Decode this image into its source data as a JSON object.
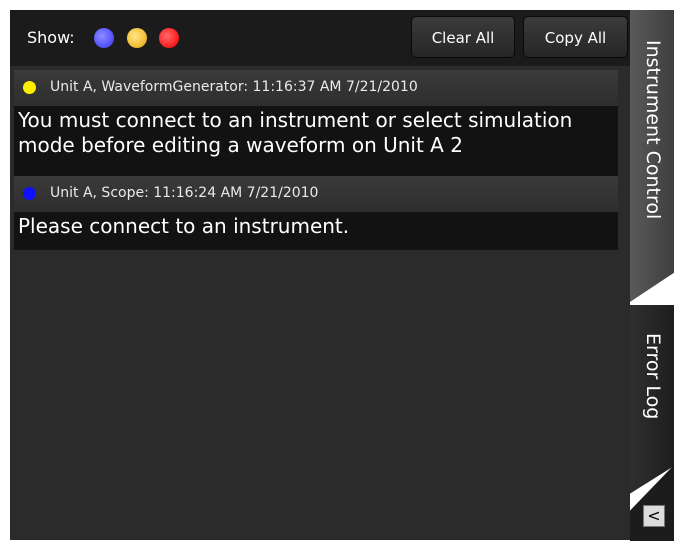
{
  "toolbar": {
    "show_label": "Show:",
    "filters": [
      {
        "name": "blue",
        "color": "#5a5aff"
      },
      {
        "name": "yellow",
        "color": "#f3c33c"
      },
      {
        "name": "red",
        "color": "#ff2a2a"
      }
    ],
    "clear_all_label": "Clear All",
    "copy_all_label": "Copy All"
  },
  "entries": [
    {
      "level_color": "#ffee00",
      "header": "Unit A, WaveformGenerator:  11:16:37 AM 7/21/2010",
      "message": "You must connect to an instrument or select simulation mode before editing a waveform on Unit A 2"
    },
    {
      "level_color": "#1010ff",
      "header": "Unit A, Scope:  11:16:24 AM 7/21/2010",
      "message": "Please connect to an instrument."
    }
  ],
  "side_tabs": {
    "instrument_control": "Instrument Control",
    "error_log": "Error Log",
    "collapse_glyph": "<"
  }
}
